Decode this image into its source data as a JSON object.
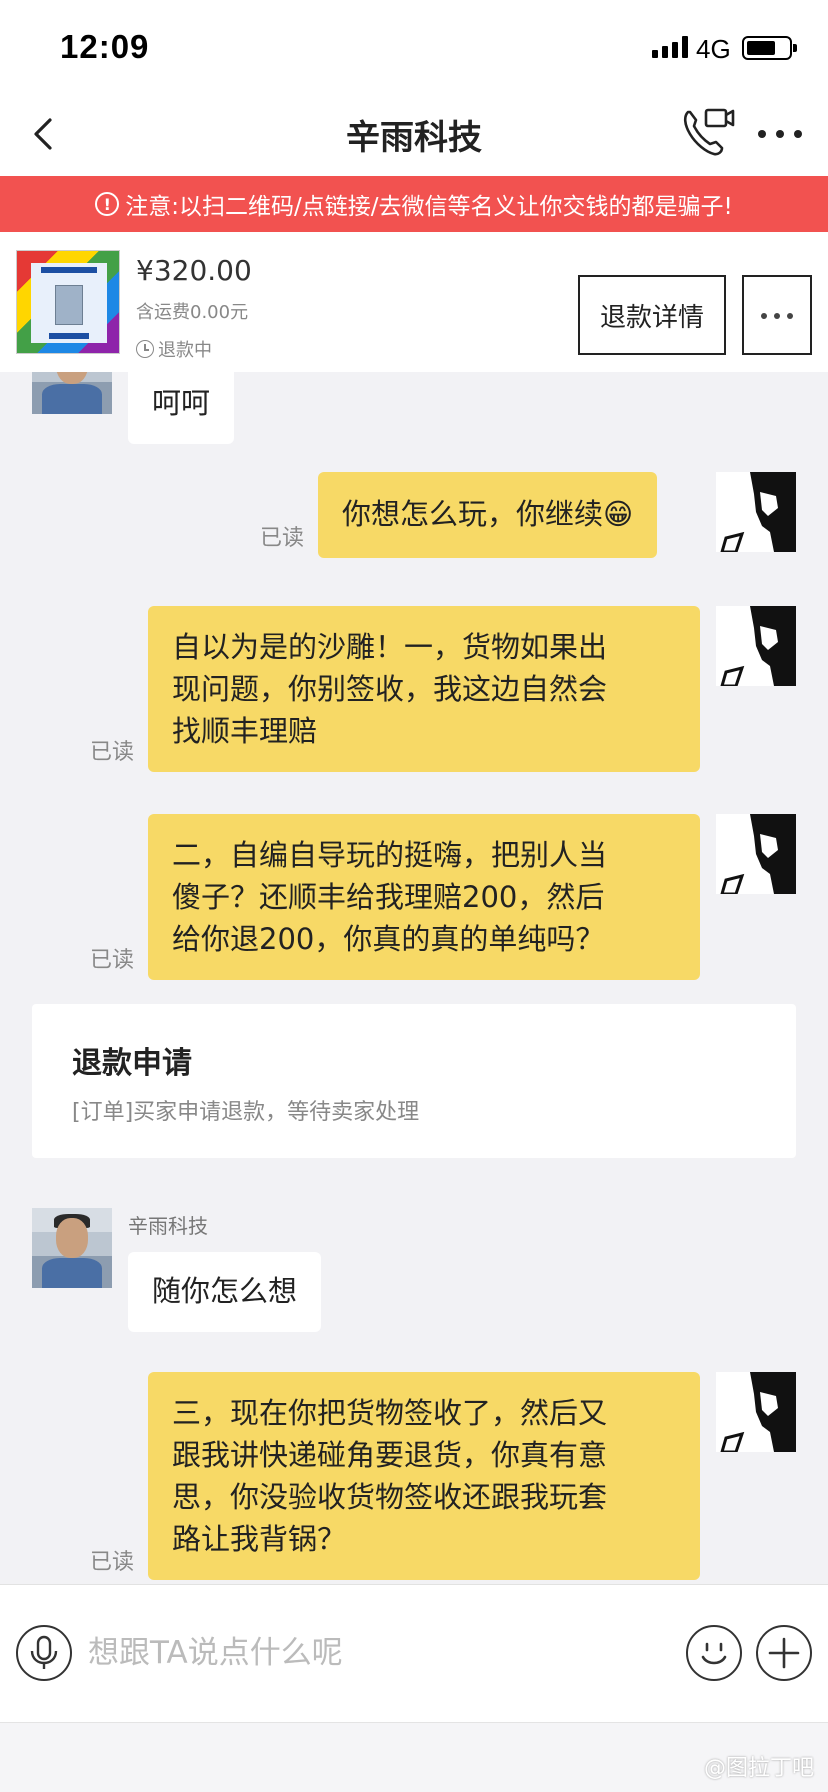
{
  "status_bar": {
    "time": "12:09",
    "network": "4G"
  },
  "nav": {
    "title": "辛雨科技",
    "icons": [
      "back-icon",
      "video-call-icon",
      "more-icon"
    ]
  },
  "warning": {
    "text": "注意:以扫二维码/点链接/去微信等名义让你交钱的都是骗子!"
  },
  "product": {
    "price": "¥320.00",
    "shipping": "含运费0.00元",
    "status": "退款中",
    "refund_detail_button": "退款详情"
  },
  "messages": [
    {
      "side": "in",
      "text": "呵呵"
    },
    {
      "side": "out",
      "read": "已读",
      "text": "你想怎么玩，你继续😁"
    },
    {
      "side": "out",
      "read": "已读",
      "lines": [
        "自以为是的沙雕！一，货物如果出",
        "现问题，你别签收，我这边自然会",
        "找顺丰理赔"
      ]
    },
    {
      "side": "out",
      "read": "已读",
      "lines": [
        "二，自编自导玩的挺嗨，把别人当",
        "傻子？还顺丰给我理赔200，然后",
        "给你退200，你真的真的单纯吗？"
      ]
    },
    {
      "type": "refund_card",
      "title": "退款申请",
      "desc": "[订单]买家申请退款，等待卖家处理"
    },
    {
      "side": "in",
      "sender": "辛雨科技",
      "text": "随你怎么想"
    },
    {
      "side": "out",
      "read": "已读",
      "lines": [
        "三，现在你把货物签收了，然后又",
        "跟我讲快递碰角要退货，你真有意",
        "思，你没验收货物签收还跟我玩套",
        "路让我背锅？"
      ]
    }
  ],
  "input": {
    "placeholder": "想跟TA说点什么呢"
  },
  "watermark": "@图拉丁吧",
  "colors": {
    "warning_bg": "#f25250",
    "outgoing_bubble": "#f7d966",
    "chat_bg": "#f2f2f5"
  }
}
